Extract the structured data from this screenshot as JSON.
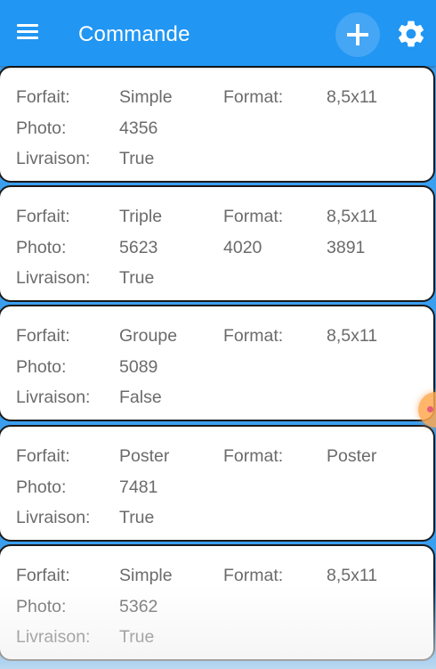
{
  "header": {
    "title": "Commande",
    "bg_color": "#2196f3",
    "menu_icon": "hamburger-menu-icon",
    "add_icon": "plus-icon",
    "settings_icon": "gear-icon"
  },
  "labels": {
    "forfait": "Forfait:",
    "format": "Format:",
    "photo": "Photo:",
    "livraison": "Livraison:"
  },
  "orders": [
    {
      "forfait": "Simple",
      "format": "8,5x11",
      "photos": [
        "4356"
      ],
      "livraison": "True"
    },
    {
      "forfait": "Triple",
      "format": "8,5x11",
      "photos": [
        "5623",
        "4020",
        "3891"
      ],
      "livraison": "True"
    },
    {
      "forfait": "Groupe",
      "format": "8,5x11",
      "photos": [
        "5089"
      ],
      "livraison": "False"
    },
    {
      "forfait": "Poster",
      "format": "Poster",
      "photos": [
        "7481"
      ],
      "livraison": "True"
    },
    {
      "forfait": "Simple",
      "format": "8,5x11",
      "photos": [
        "5362"
      ],
      "livraison": "True"
    }
  ]
}
